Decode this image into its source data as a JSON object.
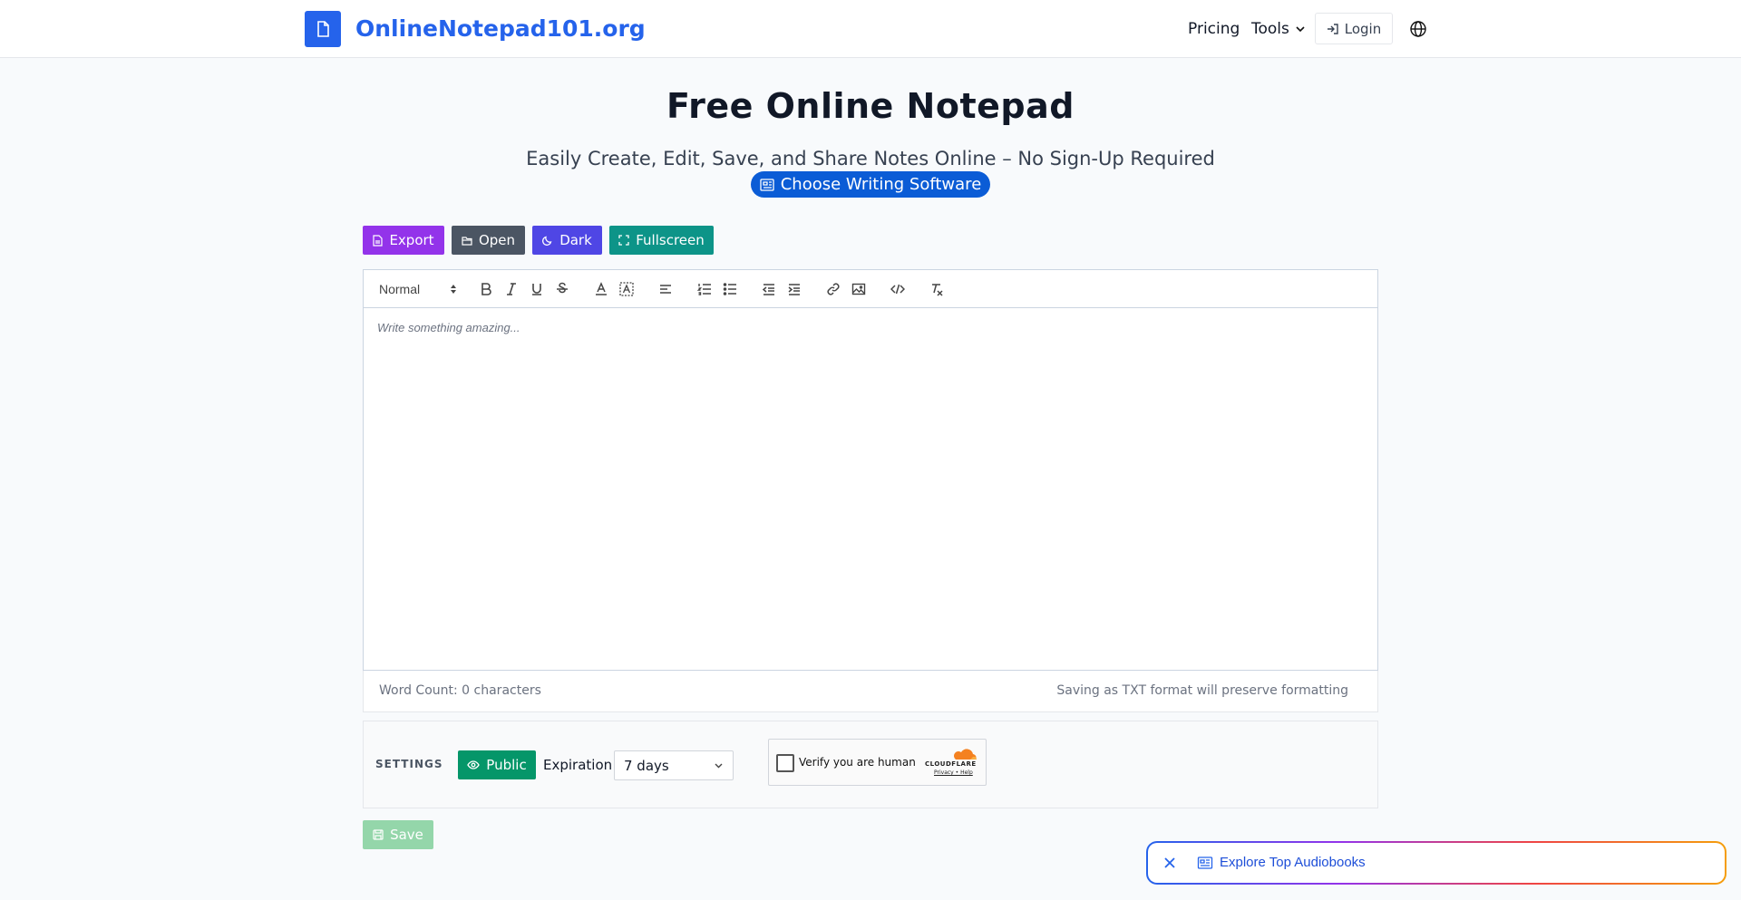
{
  "header": {
    "brand": "OnlineNotepad101.org",
    "nav_pricing": "Pricing",
    "nav_tools": "Tools",
    "login": "Login"
  },
  "hero": {
    "title": "Free Online Notepad",
    "subtitle": "Easily Create, Edit, Save, and Share Notes Online – No Sign-Up Required",
    "choose_software": "Choose Writing Software"
  },
  "actions": {
    "export": "Export",
    "open": "Open",
    "dark": "Dark",
    "fullscreen": "Fullscreen"
  },
  "editor": {
    "size_value": "Normal",
    "placeholder": "Write something amazing...",
    "word_count": "Word Count: 0 characters",
    "format_note": "Saving as TXT format will preserve formatting"
  },
  "settings": {
    "label": "SETTINGS",
    "visibility": "Public",
    "expiration_label": "Expiration",
    "expiration_value": "7 days"
  },
  "captcha": {
    "text": "Verify you are human",
    "brand": "CLOUDFLARE",
    "links": "Privacy • Help"
  },
  "save": "Save",
  "promo": {
    "text": "Explore Top Audiobooks"
  },
  "colors": {
    "brand": "#2563eb",
    "export": "#9333ea",
    "open": "#4b5563",
    "dark": "#4f46e5",
    "fullscreen": "#0d9488",
    "public": "#059669"
  }
}
